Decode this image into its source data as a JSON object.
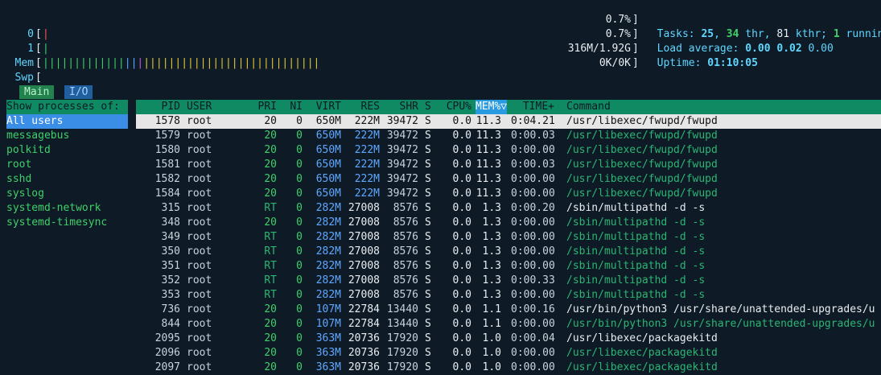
{
  "meters": {
    "cpu0": {
      "label": "0",
      "value": "0.7%"
    },
    "cpu1": {
      "label": "1",
      "value": "0.7%"
    },
    "mem": {
      "label": "Mem",
      "value": "316M/1.92G"
    },
    "swp": {
      "label": "Swp",
      "value": "0K/0K"
    }
  },
  "tasks": {
    "label": "Tasks:",
    "procs": "25",
    "sep1": ",",
    "threads": "34",
    "thr_label": "thr,",
    "kthr": "81",
    "kthr_label": "kthr;",
    "running": "1",
    "running_label": "running"
  },
  "load": {
    "label": "Load average:",
    "l1": "0.00",
    "l5": "0.02",
    "l15": "0.00"
  },
  "uptime": {
    "label": "Uptime:",
    "value": "01:10:05"
  },
  "tabs": {
    "main": "Main",
    "io": "I/O"
  },
  "left_panel": {
    "header": "Show processes of:",
    "items": [
      "All users",
      "messagebus",
      "polkitd",
      "root",
      "sshd",
      "syslog",
      "systemd-network",
      "systemd-timesync"
    ]
  },
  "columns": {
    "pid": "PID",
    "user": "USER",
    "pri": "PRI",
    "ni": "NI",
    "virt": "VIRT",
    "res": "RES",
    "shr": "SHR",
    "s": "S",
    "cpu": "CPU%",
    "mem": "MEM%▽",
    "time": "TIME+",
    "cmd": "Command"
  },
  "processes": [
    {
      "pid": "1578",
      "user": "root",
      "pri": "20",
      "ni": "0",
      "virt": "650M",
      "res": "222M",
      "shr": "39472",
      "s": "S",
      "cpu": "0.0",
      "mem": "11.3",
      "time": "0:04.21",
      "cmd": "/usr/libexec/fwupd/fwupd",
      "thread": false
    },
    {
      "pid": "1579",
      "user": "root",
      "pri": "20",
      "ni": "0",
      "virt": "650M",
      "res": "222M",
      "shr": "39472",
      "s": "S",
      "cpu": "0.0",
      "mem": "11.3",
      "time": "0:00.03",
      "cmd": "/usr/libexec/fwupd/fwupd",
      "thread": true
    },
    {
      "pid": "1580",
      "user": "root",
      "pri": "20",
      "ni": "0",
      "virt": "650M",
      "res": "222M",
      "shr": "39472",
      "s": "S",
      "cpu": "0.0",
      "mem": "11.3",
      "time": "0:00.00",
      "cmd": "/usr/libexec/fwupd/fwupd",
      "thread": true
    },
    {
      "pid": "1581",
      "user": "root",
      "pri": "20",
      "ni": "0",
      "virt": "650M",
      "res": "222M",
      "shr": "39472",
      "s": "S",
      "cpu": "0.0",
      "mem": "11.3",
      "time": "0:00.03",
      "cmd": "/usr/libexec/fwupd/fwupd",
      "thread": true
    },
    {
      "pid": "1582",
      "user": "root",
      "pri": "20",
      "ni": "0",
      "virt": "650M",
      "res": "222M",
      "shr": "39472",
      "s": "S",
      "cpu": "0.0",
      "mem": "11.3",
      "time": "0:00.00",
      "cmd": "/usr/libexec/fwupd/fwupd",
      "thread": true
    },
    {
      "pid": "1584",
      "user": "root",
      "pri": "20",
      "ni": "0",
      "virt": "650M",
      "res": "222M",
      "shr": "39472",
      "s": "S",
      "cpu": "0.0",
      "mem": "11.3",
      "time": "0:00.00",
      "cmd": "/usr/libexec/fwupd/fwupd",
      "thread": true
    },
    {
      "pid": "315",
      "user": "root",
      "pri": "RT",
      "ni": "0",
      "virt": "282M",
      "res": "27008",
      "shr": "8576",
      "s": "S",
      "cpu": "0.0",
      "mem": "1.3",
      "time": "0:00.20",
      "cmd": "/sbin/multipathd -d -s",
      "thread": false
    },
    {
      "pid": "348",
      "user": "root",
      "pri": "20",
      "ni": "0",
      "virt": "282M",
      "res": "27008",
      "shr": "8576",
      "s": "S",
      "cpu": "0.0",
      "mem": "1.3",
      "time": "0:00.00",
      "cmd": "/sbin/multipathd -d -s",
      "thread": true
    },
    {
      "pid": "349",
      "user": "root",
      "pri": "RT",
      "ni": "0",
      "virt": "282M",
      "res": "27008",
      "shr": "8576",
      "s": "S",
      "cpu": "0.0",
      "mem": "1.3",
      "time": "0:00.00",
      "cmd": "/sbin/multipathd -d -s",
      "thread": true
    },
    {
      "pid": "350",
      "user": "root",
      "pri": "RT",
      "ni": "0",
      "virt": "282M",
      "res": "27008",
      "shr": "8576",
      "s": "S",
      "cpu": "0.0",
      "mem": "1.3",
      "time": "0:00.00",
      "cmd": "/sbin/multipathd -d -s",
      "thread": true
    },
    {
      "pid": "351",
      "user": "root",
      "pri": "RT",
      "ni": "0",
      "virt": "282M",
      "res": "27008",
      "shr": "8576",
      "s": "S",
      "cpu": "0.0",
      "mem": "1.3",
      "time": "0:00.00",
      "cmd": "/sbin/multipathd -d -s",
      "thread": true
    },
    {
      "pid": "352",
      "user": "root",
      "pri": "RT",
      "ni": "0",
      "virt": "282M",
      "res": "27008",
      "shr": "8576",
      "s": "S",
      "cpu": "0.0",
      "mem": "1.3",
      "time": "0:00.33",
      "cmd": "/sbin/multipathd -d -s",
      "thread": true
    },
    {
      "pid": "353",
      "user": "root",
      "pri": "RT",
      "ni": "0",
      "virt": "282M",
      "res": "27008",
      "shr": "8576",
      "s": "S",
      "cpu": "0.0",
      "mem": "1.3",
      "time": "0:00.00",
      "cmd": "/sbin/multipathd -d -s",
      "thread": true
    },
    {
      "pid": "736",
      "user": "root",
      "pri": "20",
      "ni": "0",
      "virt": "107M",
      "res": "22784",
      "shr": "13440",
      "s": "S",
      "cpu": "0.0",
      "mem": "1.1",
      "time": "0:00.16",
      "cmd": "/usr/bin/python3 /usr/share/unattended-upgrades/u",
      "thread": false
    },
    {
      "pid": "844",
      "user": "root",
      "pri": "20",
      "ni": "0",
      "virt": "107M",
      "res": "22784",
      "shr": "13440",
      "s": "S",
      "cpu": "0.0",
      "mem": "1.1",
      "time": "0:00.00",
      "cmd": "/usr/bin/python3 /usr/share/unattended-upgrades/u",
      "thread": true
    },
    {
      "pid": "2095",
      "user": "root",
      "pri": "20",
      "ni": "0",
      "virt": "363M",
      "res": "20736",
      "shr": "17920",
      "s": "S",
      "cpu": "0.0",
      "mem": "1.0",
      "time": "0:00.04",
      "cmd": "/usr/libexec/packagekitd",
      "thread": false
    },
    {
      "pid": "2096",
      "user": "root",
      "pri": "20",
      "ni": "0",
      "virt": "363M",
      "res": "20736",
      "shr": "17920",
      "s": "S",
      "cpu": "0.0",
      "mem": "1.0",
      "time": "0:00.00",
      "cmd": "/usr/libexec/packagekitd",
      "thread": true
    },
    {
      "pid": "2097",
      "user": "root",
      "pri": "20",
      "ni": "0",
      "virt": "363M",
      "res": "20736",
      "shr": "17920",
      "s": "S",
      "cpu": "0.0",
      "mem": "1.0",
      "time": "0:00.00",
      "cmd": "/usr/libexec/packagekitd",
      "thread": true
    }
  ],
  "colors": {
    "header_bg": "#0f8a63",
    "selected_bg": "#3a8ee6",
    "thread_cmd": "#2bb673",
    "process_cmd": "#3fd06a"
  }
}
